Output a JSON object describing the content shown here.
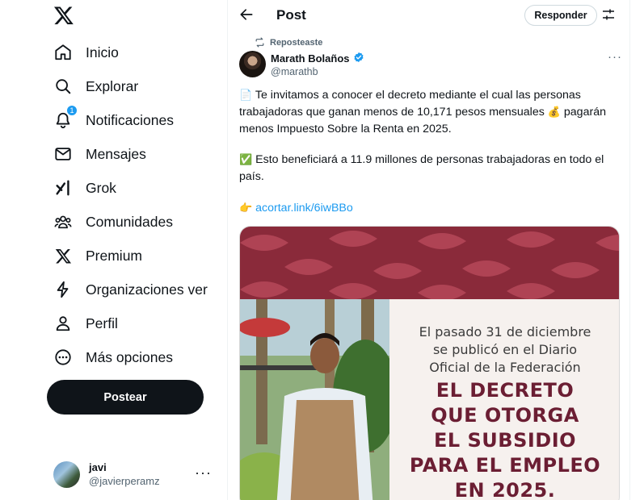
{
  "sidebar": {
    "logo": "x-logo-icon",
    "items": [
      {
        "label": "Inicio",
        "icon": "home-icon"
      },
      {
        "label": "Explorar",
        "icon": "search-icon"
      },
      {
        "label": "Notificaciones",
        "icon": "bell-icon",
        "badge": "1"
      },
      {
        "label": "Mensajes",
        "icon": "mail-icon"
      },
      {
        "label": "Grok",
        "icon": "grok-icon"
      },
      {
        "label": "Comunidades",
        "icon": "communities-icon"
      },
      {
        "label": "Premium",
        "icon": "x-logo-icon"
      },
      {
        "label": "Organizaciones ver",
        "icon": "lightning-icon"
      },
      {
        "label": "Perfil",
        "icon": "person-icon"
      },
      {
        "label": "Más opciones",
        "icon": "more-circle-icon"
      }
    ],
    "post_button": "Postear",
    "account": {
      "name": "javi",
      "handle": "@javierperamz"
    }
  },
  "header": {
    "title": "Post",
    "reply_button": "Responder"
  },
  "tweet": {
    "repost_label": "Reposteaste",
    "author_name": "Marath Bolaños",
    "author_handle": "@marathb",
    "para1_emoji": "📄",
    "para1": "Te invitamos a conocer el decreto mediante el cual las personas trabajadoras que ganan menos de 10,171 pesos mensuales",
    "para1_emoji2": "💰",
    "para1_tail": "pagarán menos Impuesto Sobre la Renta en 2025.",
    "para2_emoji": "✅",
    "para2": "Esto beneficiará a 11.9 millones de personas trabajadoras en todo el país.",
    "para3_emoji": "👉",
    "link": "acortar.link/6iwBBo",
    "media": {
      "intro_line1": "El pasado 31 de diciembre",
      "intro_line2": "se publicó en el Diario",
      "intro_line3": "Oficial de la Federación",
      "decree_line1": "EL DECRETO",
      "decree_line2": "QUE OTORGA",
      "decree_line3": "EL SUBSIDIO",
      "decree_line4": "PARA EL EMPLEO",
      "decree_line5": "EN 2025."
    }
  },
  "colors": {
    "accent": "#1d9bf0",
    "primary_text": "#0f1419",
    "secondary_text": "#536471",
    "banner_red": "#8a2a3a",
    "decree_red": "#6b1e33"
  }
}
